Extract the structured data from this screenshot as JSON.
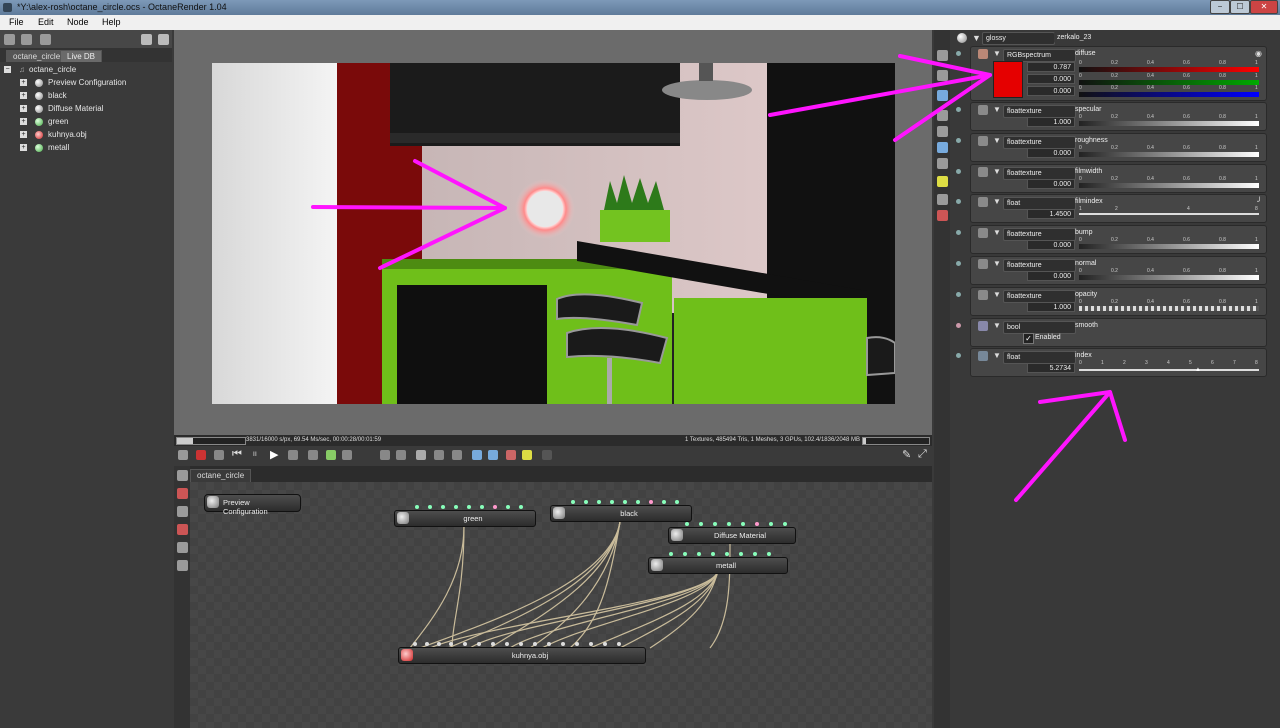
{
  "window": {
    "title": "*Y:\\alex-rosh\\octane_circle.ocs - OctaneRender 1.04",
    "min": "−",
    "max": "☐",
    "close": "✕"
  },
  "menu": [
    "File",
    "Edit",
    "Node",
    "Help"
  ],
  "scene": {
    "tabs": [
      "octane_circle",
      "Live DB"
    ],
    "root": "octane_circle",
    "items": [
      "Preview Configuration",
      "black",
      "Diffuse Material",
      "green",
      "kuhnya.obj",
      "metall"
    ]
  },
  "status": {
    "left": "3831/16000 s/px, 69.54 Ms/sec, 00:00:28/00:01:59",
    "right": "1 Textures, 485494 Tris, 1 Meshes, 3 GPUs, 102.4/1836/2048 MB"
  },
  "graph": {
    "tab": "octane_circle",
    "nodes": {
      "preview": "Preview Configuration",
      "green": "green",
      "black": "black",
      "diffuse": "Diffuse Material",
      "metall": "metall",
      "kuhnya": "kuhnya.obj"
    }
  },
  "inspector": {
    "material_type": "glossy",
    "material_name": "zerkalo_23",
    "diffuse": {
      "type": "RGBspectrum",
      "name": "diffuse",
      "r": "0.787",
      "g": "0.000",
      "b": "0.000",
      "swatch_color": "#e50000"
    },
    "params": [
      {
        "type": "floattexture",
        "name": "specular",
        "value": "1.000"
      },
      {
        "type": "floattexture",
        "name": "roughness",
        "value": "0.000"
      },
      {
        "type": "floattexture",
        "name": "filmwidth",
        "value": "0.000"
      },
      {
        "type": "float",
        "name": "filmindex",
        "value": "1.4500"
      },
      {
        "type": "floattexture",
        "name": "bump",
        "value": "0.000"
      },
      {
        "type": "floattexture",
        "name": "normal",
        "value": "0.000"
      },
      {
        "type": "floattexture",
        "name": "opacity",
        "value": "1.000"
      }
    ],
    "smooth": {
      "type": "bool",
      "name": "smooth",
      "checkbox_label": "Enabled"
    },
    "index": {
      "type": "float",
      "name": "index",
      "value": "5.2734"
    },
    "ticks01": [
      "0",
      "0.2",
      "0.4",
      "0.6",
      "0.8",
      "1"
    ],
    "ticks_filmindex": [
      "1",
      "2",
      "4",
      "8"
    ],
    "ticks_index": [
      "0",
      "1",
      "2",
      "3",
      "4",
      "5",
      "6",
      "7",
      "8"
    ]
  },
  "colors": {
    "annotation": "#ff14ff",
    "accent_green": "#6fbf1a"
  }
}
